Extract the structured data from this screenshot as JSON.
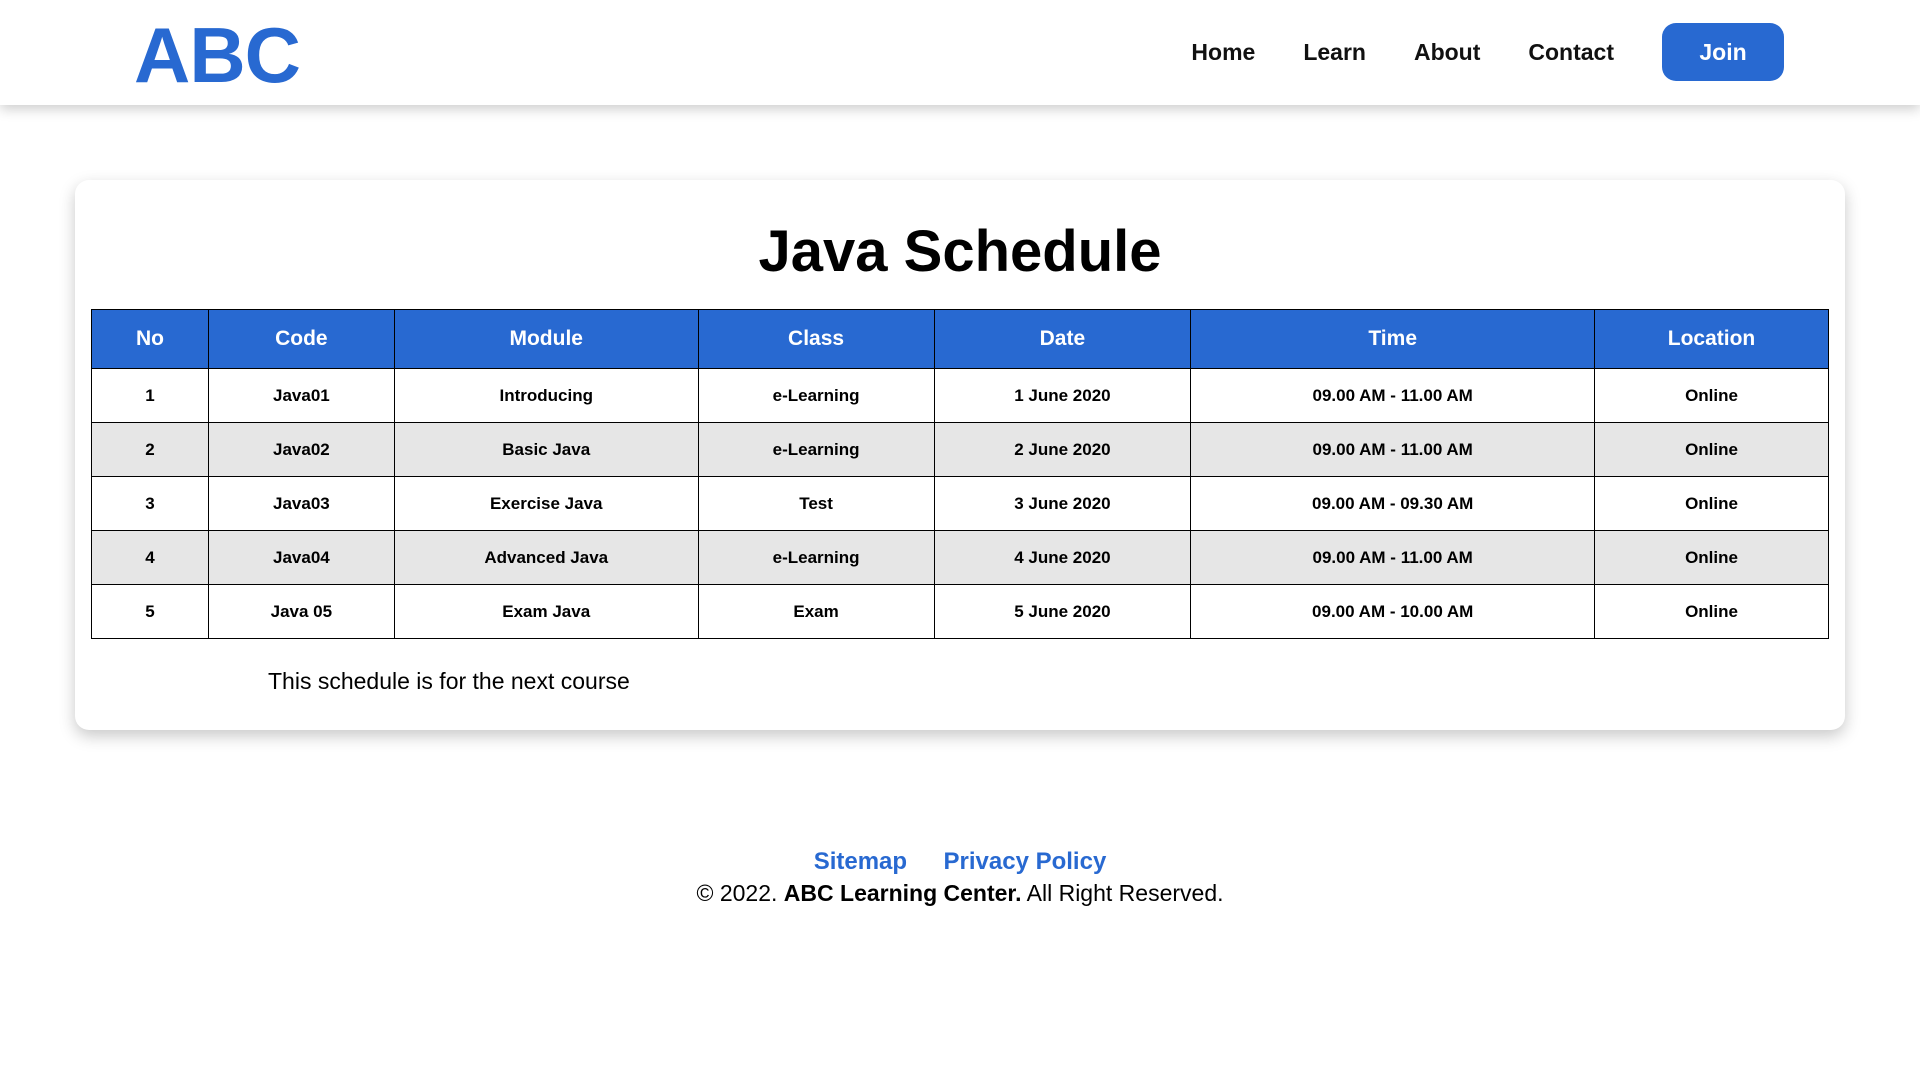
{
  "header": {
    "logo": "ABC",
    "nav": [
      "Home",
      "Learn",
      "About",
      "Contact"
    ],
    "join": "Join"
  },
  "main": {
    "title": "Java Schedule",
    "columns": [
      "No",
      "Code",
      "Module",
      "Class",
      "Date",
      "Time",
      "Location"
    ],
    "rows": [
      [
        "1",
        "Java01",
        "Introducing",
        "e-Learning",
        "1 June 2020",
        "09.00 AM - 11.00 AM",
        "Online"
      ],
      [
        "2",
        "Java02",
        "Basic Java",
        "e-Learning",
        "2 June 2020",
        "09.00 AM - 11.00 AM",
        "Online"
      ],
      [
        "3",
        "Java03",
        "Exercise Java",
        "Test",
        "3 June 2020",
        "09.00 AM - 09.30 AM",
        "Online"
      ],
      [
        "4",
        "Java04",
        "Advanced Java",
        "e-Learning",
        "4 June 2020",
        "09.00 AM - 11.00 AM",
        "Online"
      ],
      [
        "5",
        "Java 05",
        "Exam Java",
        "Exam",
        "5 June 2020",
        "09.00 AM - 10.00 AM",
        "Online"
      ]
    ],
    "note": "This schedule is for the next course"
  },
  "footer": {
    "links": [
      "Sitemap",
      "Privacy Policy"
    ],
    "copy_prefix": "© 2022.",
    "copy_brand": "ABC Learning Center.",
    "copy_suffix": "All Right Reserved."
  },
  "colors": {
    "accent": "#2869d1",
    "row_alt": "#e6e6e6"
  }
}
